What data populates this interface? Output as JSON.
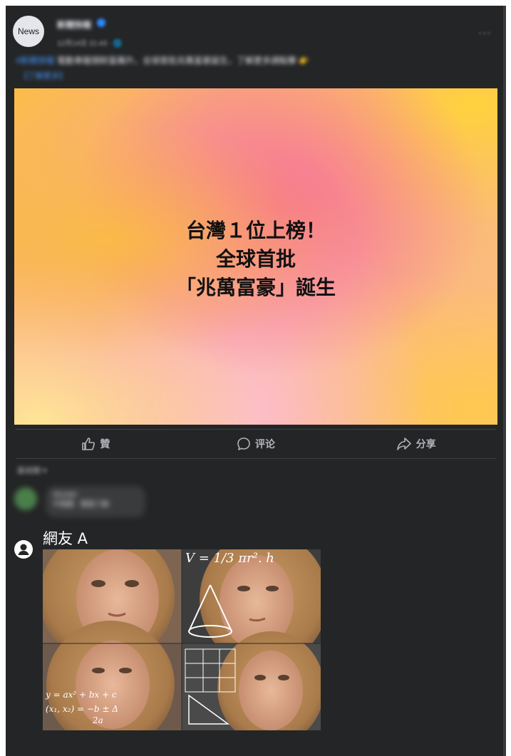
{
  "post": {
    "avatar_text": "News",
    "page_name": "新聞快報",
    "timestamp": "12月14日 21:43 · 🌐",
    "more_label": "···",
    "caption_hashtag": "#新聞快報",
    "caption_text": "電動車龍頭財富飆升，全球首批兆萬富豪誕生，了解更多請點擊 👉",
    "caption_link": "【了解更多】",
    "headline": [
      "台灣１位上榜！",
      "全球首批",
      "「兆萬富豪」誕生"
    ]
  },
  "actions": {
    "like": "贊",
    "comment": "评论",
    "share": "分享"
  },
  "comments": {
    "sort_label": "最相關 ▾",
    "blurred_name": "Wonder",
    "blurred_text": "不需要 · 贊我了解",
    "commenter_name": "網友 A"
  },
  "icons": {
    "avatar": "news-avatar-icon",
    "verified": "verified-badge-icon",
    "more": "more-options-icon",
    "like": "thumbs-up-icon",
    "comment": "speech-bubble-icon",
    "share": "share-arrow-icon",
    "user": "user-avatar-icon"
  },
  "colors": {
    "background": "#242526",
    "text_primary": "#e4e6eb",
    "text_secondary": "#b0b3b8",
    "link": "#4599ff",
    "divider": "#3e4042"
  }
}
